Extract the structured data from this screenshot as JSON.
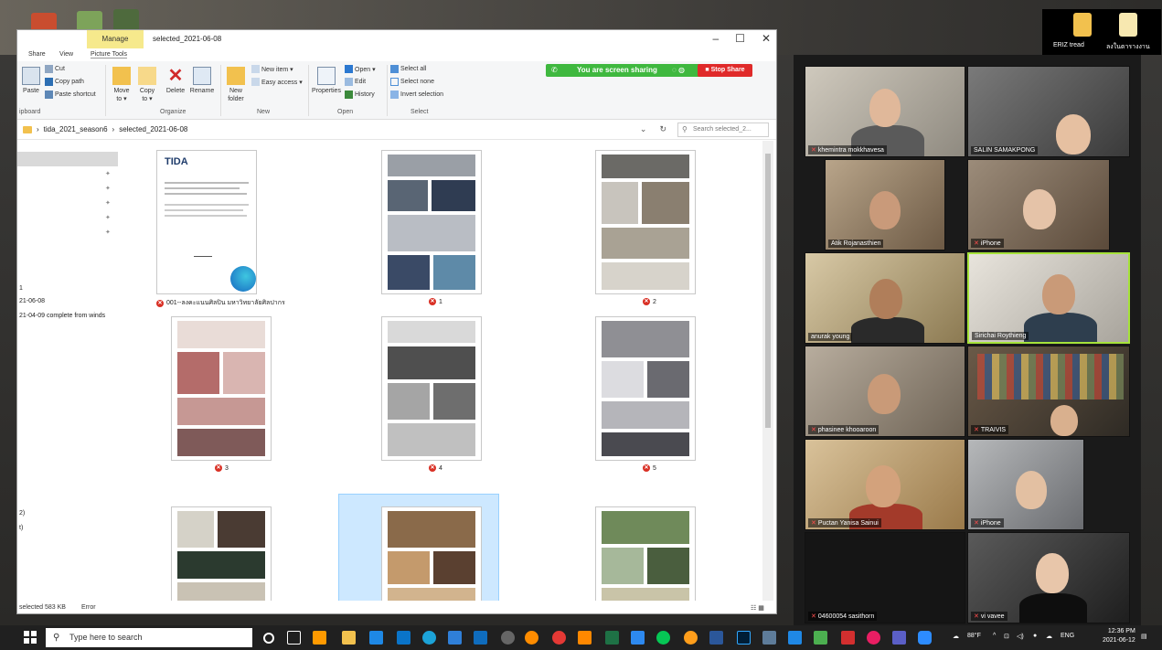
{
  "desktop": {
    "icons_right": [
      "ERIZ tread",
      "ลงในตารางงาน"
    ]
  },
  "explorer": {
    "contextual_tab": "Manage",
    "window_title": "selected_2021-06-08",
    "controls": {
      "minimize": "–",
      "maximize": "☐",
      "close": "✕"
    },
    "ribbon_tabs": [
      "Share",
      "View",
      "Picture Tools"
    ],
    "ribbon": {
      "clipboard": {
        "paste": "Paste",
        "cut": "Cut",
        "copy_path": "Copy path",
        "paste_shortcut": "Paste shortcut",
        "group": "ipboard"
      },
      "organize": {
        "move_to": "Move to ▾",
        "copy_to": "Copy to ▾",
        "delete": "Delete",
        "rename": "Rename",
        "group": "Organize"
      },
      "new": {
        "new_folder": "New folder",
        "new_item": "New item ▾",
        "easy_access": "Easy access ▾",
        "group": "New"
      },
      "open": {
        "properties": "Properties",
        "open": "Open ▾",
        "edit": "Edit",
        "history": "History",
        "group": "Open"
      },
      "select": {
        "select_all": "Select all",
        "select_none": "Select none",
        "invert": "Invert selection",
        "group": "Select"
      }
    },
    "share_banner": {
      "text": "You are screen sharing",
      "stop": "Stop Share"
    },
    "address": {
      "crumbs": [
        "tida_2021_season6",
        "selected_2021-06-08"
      ],
      "search_placeholder": "Search selected_2..."
    },
    "nav": {
      "items": [
        "1",
        "21-06-08",
        "21-04-09 complete from winds",
        "2)",
        "t)"
      ]
    },
    "files": [
      {
        "label": "001--ลงคะแนนศิลปิน มหาวิทยาลัยศิลปากร"
      },
      {
        "label": "1"
      },
      {
        "label": "2"
      },
      {
        "label": "3"
      },
      {
        "label": "4"
      },
      {
        "label": "5"
      },
      {
        "label": ""
      },
      {
        "label": ""
      },
      {
        "label": ""
      }
    ],
    "thumb_text": {
      "tida_logo": "TIDA"
    },
    "status": {
      "selected": "selected 583 KB",
      "error": "Error"
    }
  },
  "zoom": {
    "participants": [
      {
        "name": "khemintra mokkhavesa"
      },
      {
        "name": "SALIN SAMAKPONG"
      },
      {
        "name": "Atik Rojanasthien"
      },
      {
        "name": "iPhone"
      },
      {
        "name": "anurak young"
      },
      {
        "name": "Sirichai Roythieng"
      },
      {
        "name": "phasinee khooaroon"
      },
      {
        "name": "TRAIVIS"
      },
      {
        "name": "Puctan Yanisa Sainui"
      },
      {
        "name": "iPhone"
      },
      {
        "name": "04600054 sasithorn"
      },
      {
        "name": "vi vavee"
      }
    ]
  },
  "taskbar": {
    "search_placeholder": "Type here to search",
    "weather": "88°F",
    "lang": "ENG",
    "time": "12:36 PM",
    "date": "2021-06-12"
  }
}
